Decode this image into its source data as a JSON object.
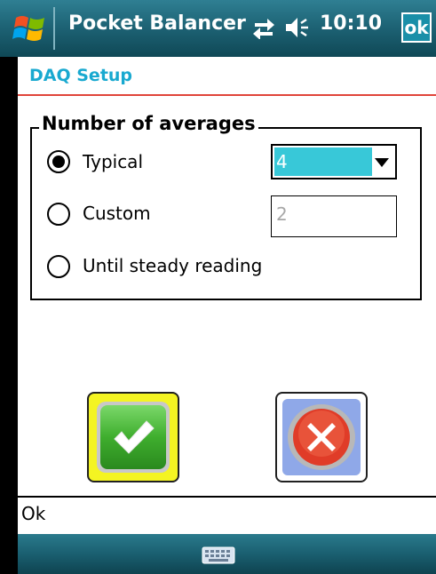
{
  "titlebar": {
    "app_title": "Pocket Balancer",
    "clock": "10:10",
    "ok_label": "ok",
    "start_icon": "windows-flag-icon",
    "connectivity_icon": "connectivity-arrows-icon",
    "volume_icon": "speaker-icon"
  },
  "page": {
    "title": "DAQ Setup",
    "accent_color": "#19a9d0",
    "rule_color": "#e0453a"
  },
  "averages_group": {
    "legend": "Number of averages",
    "options": [
      {
        "label": "Typical",
        "selected": true
      },
      {
        "label": "Custom",
        "selected": false
      },
      {
        "label": "Until steady reading",
        "selected": false
      }
    ],
    "typical_select": {
      "value": "4"
    },
    "custom_input": {
      "value": "2"
    }
  },
  "actions": {
    "confirm_icon": "checkmark-icon",
    "cancel_icon": "cancel-x-icon"
  },
  "status": {
    "text": "Ok"
  },
  "bottom_bar": {
    "keyboard_icon": "keyboard-icon"
  }
}
